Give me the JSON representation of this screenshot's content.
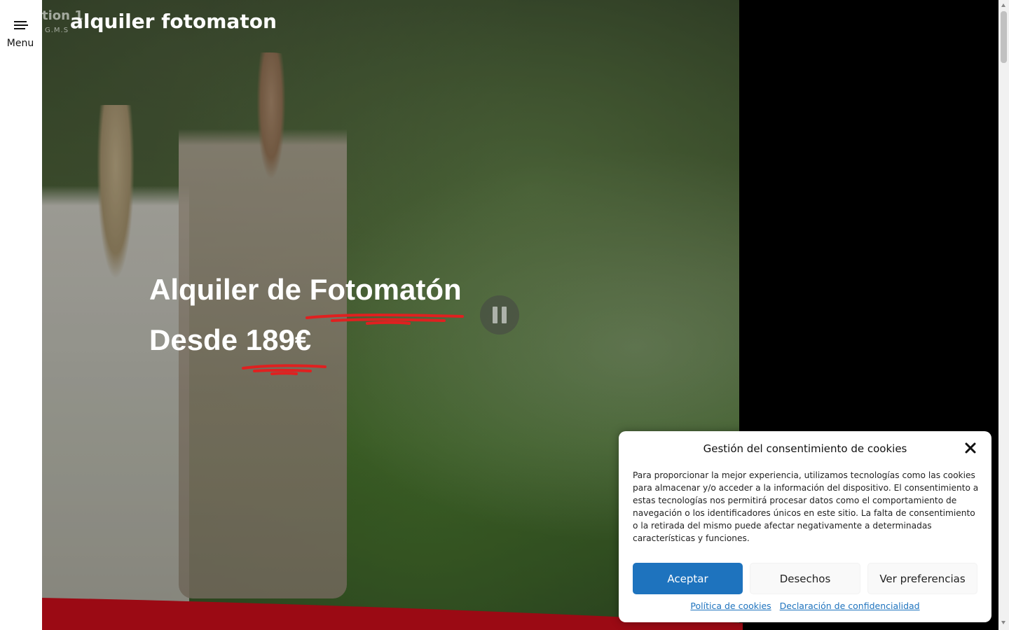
{
  "menu": {
    "label": "Menu"
  },
  "header": {
    "site_title": "alquiler fotomaton",
    "logo_ghost_text": "tion 1",
    "logo_ghost_sub": "G.M.S"
  },
  "hero": {
    "line1_prefix": "Alquiler de ",
    "line1_highlight": "Fotomatón",
    "line2_prefix": "Desde ",
    "line2_highlight": "189€",
    "accent_color": "#e02020"
  },
  "video": {
    "control_icon": "pause-icon"
  },
  "cookie_banner": {
    "title": "Gestión del consentimiento de cookies",
    "body": "Para proporcionar la mejor experiencia, utilizamos tecnologías como las cookies para almacenar y/o acceder a la información del dispositivo. El consentimiento a estas tecnologías nos permitirá procesar datos como el comportamiento de navegación o los identificadores únicos en este sitio. La falta de consentimiento o la retirada del mismo puede afectar negativamente a determinadas características y funciones.",
    "accept_label": "Aceptar",
    "deny_label": "Desechos",
    "preferences_label": "Ver preferencias",
    "cookie_policy_link": "Política de cookies",
    "privacy_link": "Declaración de confidencialidad",
    "accept_color": "#1e73be"
  },
  "colors": {
    "band_red": "#9b0a14",
    "accent_red": "#e02020"
  }
}
